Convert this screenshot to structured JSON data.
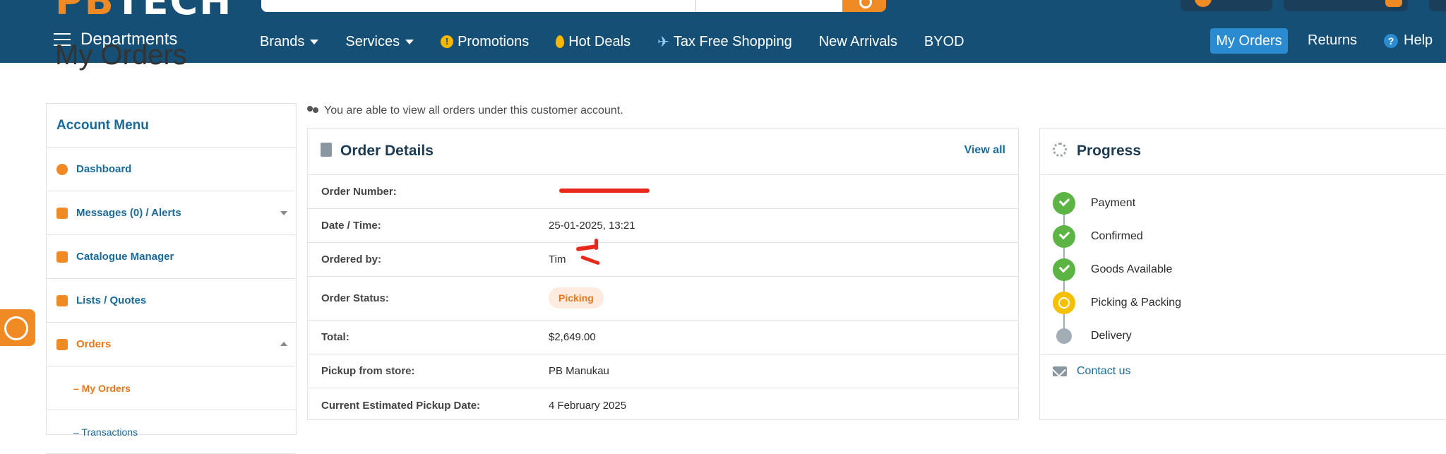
{
  "header": {
    "logo_prefix": "PB",
    "logo_suffix": "TECH",
    "departments_label": "Departments",
    "nav": [
      {
        "label": "Brands",
        "icon": "",
        "caret": true
      },
      {
        "label": "Services",
        "icon": "",
        "caret": true
      },
      {
        "label": "Promotions",
        "icon": "promotion-icon",
        "caret": false
      },
      {
        "label": "Hot Deals",
        "icon": "fire-icon",
        "caret": false
      },
      {
        "label": "Tax Free Shopping",
        "icon": "plane-icon",
        "caret": false
      },
      {
        "label": "New Arrivals",
        "icon": "",
        "caret": false
      },
      {
        "label": "BYOD",
        "icon": "",
        "caret": false
      }
    ],
    "my_orders_label": "My Orders",
    "returns_label": "Returns",
    "help_label": "Help"
  },
  "page_title": "My Orders",
  "account_menu": {
    "title": "Account Menu",
    "items": [
      {
        "label": "Dashboard",
        "icon": "dashboard-icon"
      },
      {
        "label": "Messages (0) / Alerts",
        "icon": "envelope-icon"
      },
      {
        "label": "Catalogue Manager",
        "icon": "book-icon"
      },
      {
        "label": "Lists / Quotes",
        "icon": "list-icon"
      },
      {
        "label": "Orders",
        "icon": "document-icon"
      }
    ],
    "sub_items": [
      "– My Orders",
      "– Transactions"
    ]
  },
  "info_text": "You are able to view all orders under this customer account.",
  "order_details": {
    "title": "Order Details",
    "view_all": "View all",
    "rows": [
      {
        "label": "Order Number:",
        "value": ""
      },
      {
        "label": "Date / Time:",
        "value": "25-01-2025, 13:21"
      },
      {
        "label": "Ordered by:",
        "value": "Tim"
      },
      {
        "label": "Order Status:",
        "value": "Picking"
      },
      {
        "label": "Total:",
        "value": "$2,649.00"
      },
      {
        "label": "Pickup from store:",
        "value": "PB Manukau"
      },
      {
        "label": "Current Estimated Pickup Date:",
        "value": "4 February 2025"
      }
    ]
  },
  "progress": {
    "title": "Progress",
    "steps": [
      {
        "label": "Payment",
        "state": "done"
      },
      {
        "label": "Confirmed",
        "state": "done"
      },
      {
        "label": "Goods Available",
        "state": "done"
      },
      {
        "label": "Picking & Packing",
        "state": "current"
      },
      {
        "label": "Delivery",
        "state": "pending"
      }
    ],
    "contact_label": "Contact us"
  }
}
